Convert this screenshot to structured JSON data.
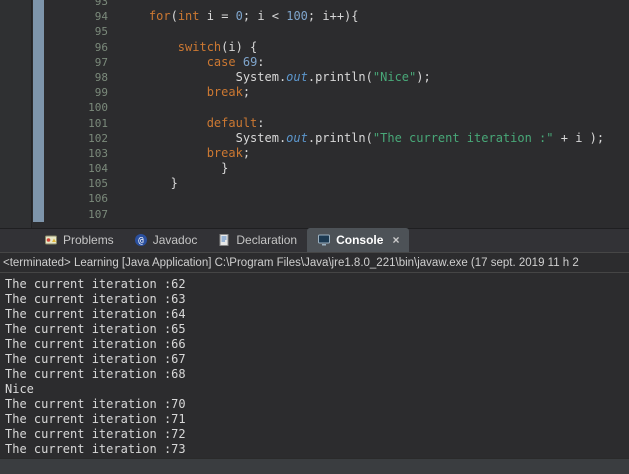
{
  "colors": {
    "editor_background": "#2c2c2e",
    "keyword": "#cc7832",
    "number": "#7fa5cc",
    "string": "#48a878",
    "field": "#5c96cc",
    "range_indicator": "#7e95ab",
    "active_tab": "#4d5257"
  },
  "icons": {
    "javadoc_glyph": "@"
  },
  "editor": {
    "lines": [
      {
        "n": 93,
        "segs": []
      },
      {
        "n": 94,
        "segs": [
          [
            "plain",
            "    "
          ],
          [
            "kw",
            "for"
          ],
          [
            "plain",
            "("
          ],
          [
            "kw",
            "int"
          ],
          [
            "plain",
            " i = "
          ],
          [
            "num",
            "0"
          ],
          [
            "plain",
            "; i < "
          ],
          [
            "num",
            "100"
          ],
          [
            "plain",
            "; i++){"
          ]
        ]
      },
      {
        "n": 95,
        "segs": []
      },
      {
        "n": 96,
        "segs": [
          [
            "plain",
            "        "
          ],
          [
            "kw",
            "switch"
          ],
          [
            "plain",
            "(i) {"
          ]
        ]
      },
      {
        "n": 97,
        "segs": [
          [
            "plain",
            "            "
          ],
          [
            "kw",
            "case"
          ],
          [
            "plain",
            " "
          ],
          [
            "num",
            "69"
          ],
          [
            "plain",
            ":"
          ]
        ]
      },
      {
        "n": 98,
        "segs": [
          [
            "plain",
            "                System."
          ],
          [
            "field",
            "out"
          ],
          [
            "plain",
            ".println("
          ],
          [
            "str",
            "\"Nice\""
          ],
          [
            "plain",
            ");"
          ]
        ]
      },
      {
        "n": 99,
        "segs": [
          [
            "plain",
            "            "
          ],
          [
            "kw",
            "break"
          ],
          [
            "plain",
            ";"
          ]
        ]
      },
      {
        "n": 100,
        "segs": []
      },
      {
        "n": 101,
        "segs": [
          [
            "plain",
            "            "
          ],
          [
            "kw",
            "default"
          ],
          [
            "plain",
            ":"
          ]
        ]
      },
      {
        "n": 102,
        "segs": [
          [
            "plain",
            "                System."
          ],
          [
            "field",
            "out"
          ],
          [
            "plain",
            ".println("
          ],
          [
            "str",
            "\"The current iteration :\""
          ],
          [
            "plain",
            " + i );"
          ]
        ]
      },
      {
        "n": 103,
        "segs": [
          [
            "plain",
            "            "
          ],
          [
            "kw",
            "break"
          ],
          [
            "plain",
            ";"
          ]
        ]
      },
      {
        "n": 104,
        "segs": [
          [
            "plain",
            "              }"
          ]
        ]
      },
      {
        "n": 105,
        "segs": [
          [
            "plain",
            "       }"
          ]
        ]
      },
      {
        "n": 106,
        "segs": []
      },
      {
        "n": 107,
        "segs": []
      }
    ]
  },
  "tabs": [
    {
      "label": "Problems"
    },
    {
      "label": "Javadoc"
    },
    {
      "label": "Declaration"
    },
    {
      "label": "Console",
      "close": "×"
    }
  ],
  "console": {
    "header": "<terminated> Learning [Java Application] C:\\Program Files\\Java\\jre1.8.0_221\\bin\\javaw.exe (17 sept. 2019 11 h 2",
    "output": [
      "The current iteration :62",
      "The current iteration :63",
      "The current iteration :64",
      "The current iteration :65",
      "The current iteration :66",
      "The current iteration :67",
      "The current iteration :68",
      "Nice",
      "The current iteration :70",
      "The current iteration :71",
      "The current iteration :72",
      "The current iteration :73"
    ]
  }
}
